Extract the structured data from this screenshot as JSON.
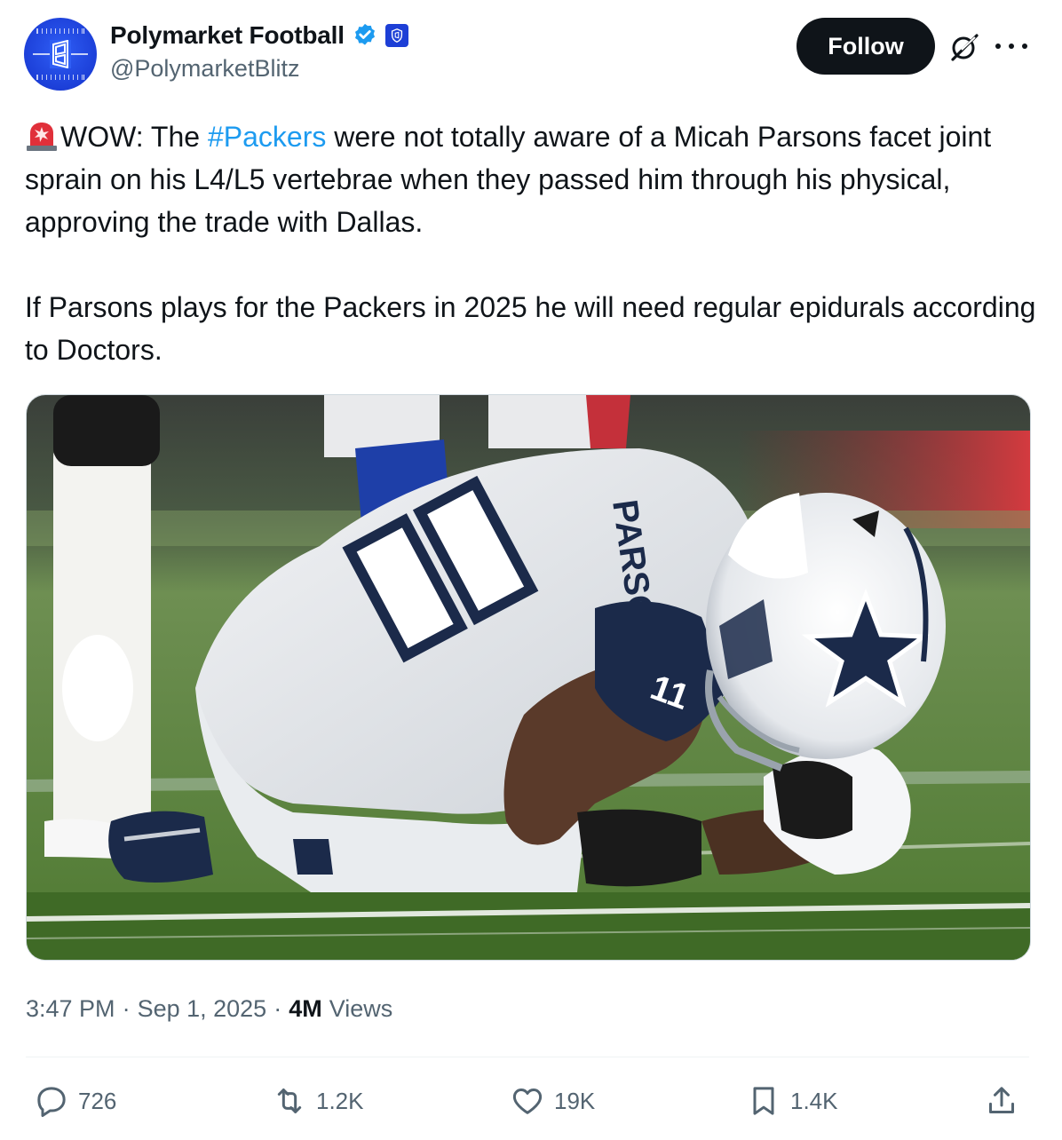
{
  "account": {
    "display_name": "Polymarket Football",
    "handle": "@PolymarketBlitz",
    "avatar_icon": "polymarket-football-field-logo",
    "verified_icon": "verified-badge-icon",
    "affiliate_icon": "polymarket-shield-badge-icon"
  },
  "header": {
    "follow_label": "Follow",
    "grok_icon": "grok-icon",
    "more_icon": "more-dots-icon"
  },
  "tweet": {
    "emoji": "rotating-light-siren-emoji",
    "line1_prefix": "WOW: The ",
    "hashtag": "#Packers",
    "line1_suffix": " were not totally aware of a Micah Parsons facet joint sprain on his L4/L5 vertebrae when they passed him through his physical, approving the trade with Dallas.",
    "paragraph2": "If Parsons plays for the Packers in 2025 he will need regular epidurals according to Doctors."
  },
  "media": {
    "jersey_number": "11",
    "jersey_name": "PARSONS",
    "accent_navy": "#1b2a4a",
    "turf_green": "#5f8a3c"
  },
  "meta": {
    "time": "3:47 PM",
    "separator": "·",
    "date": "Sep 1, 2025",
    "views_count": "4M",
    "views_label": "Views"
  },
  "actions": {
    "replies": "726",
    "reposts": "1.2K",
    "likes": "19K",
    "bookmarks": "1.4K"
  },
  "colors": {
    "accent": "#1d9bf0",
    "text": "#0f1419",
    "muted": "#536471",
    "follow_bg": "#0f1419"
  }
}
